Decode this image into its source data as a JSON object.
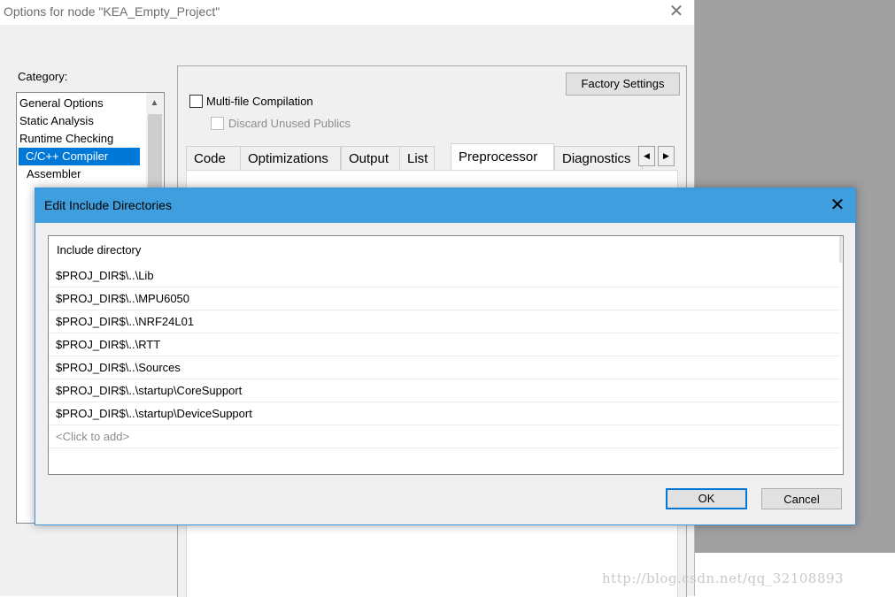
{
  "options_window": {
    "title": "Options for node \"KEA_Empty_Project\"",
    "close_glyph": "✕",
    "category_label": "Category:",
    "categories": [
      {
        "label": "General Options"
      },
      {
        "label": "Static Analysis"
      },
      {
        "label": "Runtime Checking"
      },
      {
        "label": "C/C++ Compiler",
        "selected": true
      },
      {
        "label": "Assembler"
      }
    ],
    "factory_settings_label": "Factory Settings",
    "multifile_label": "Multi-file Compilation",
    "discard_label": "Discard Unused Publics",
    "tabs": [
      "Code",
      "Optimizations",
      "Output",
      "List",
      "Preprocessor",
      "Diagnostics"
    ],
    "active_tab": "Preprocessor",
    "tab_left_glyph": "◀",
    "tab_right_glyph": "▶",
    "scroll_up_glyph": "▲"
  },
  "dialog": {
    "title": "Edit Include Directories",
    "close_glyph": "✕",
    "column_header": "Include directory",
    "directories": [
      "$PROJ_DIR$\\..\\Lib",
      "$PROJ_DIR$\\..\\MPU6050",
      "$PROJ_DIR$\\..\\NRF24L01",
      "$PROJ_DIR$\\..\\RTT",
      "$PROJ_DIR$\\..\\Sources",
      "$PROJ_DIR$\\..\\startup\\CoreSupport",
      "$PROJ_DIR$\\..\\startup\\DeviceSupport"
    ],
    "add_placeholder": "<Click to add>",
    "ok_label": "OK",
    "cancel_label": "Cancel"
  },
  "watermark": "http://blog.csdn.net/qq_32108893",
  "colors": {
    "titlebar_accent": "#3f9fde",
    "selection": "#0078d7"
  }
}
